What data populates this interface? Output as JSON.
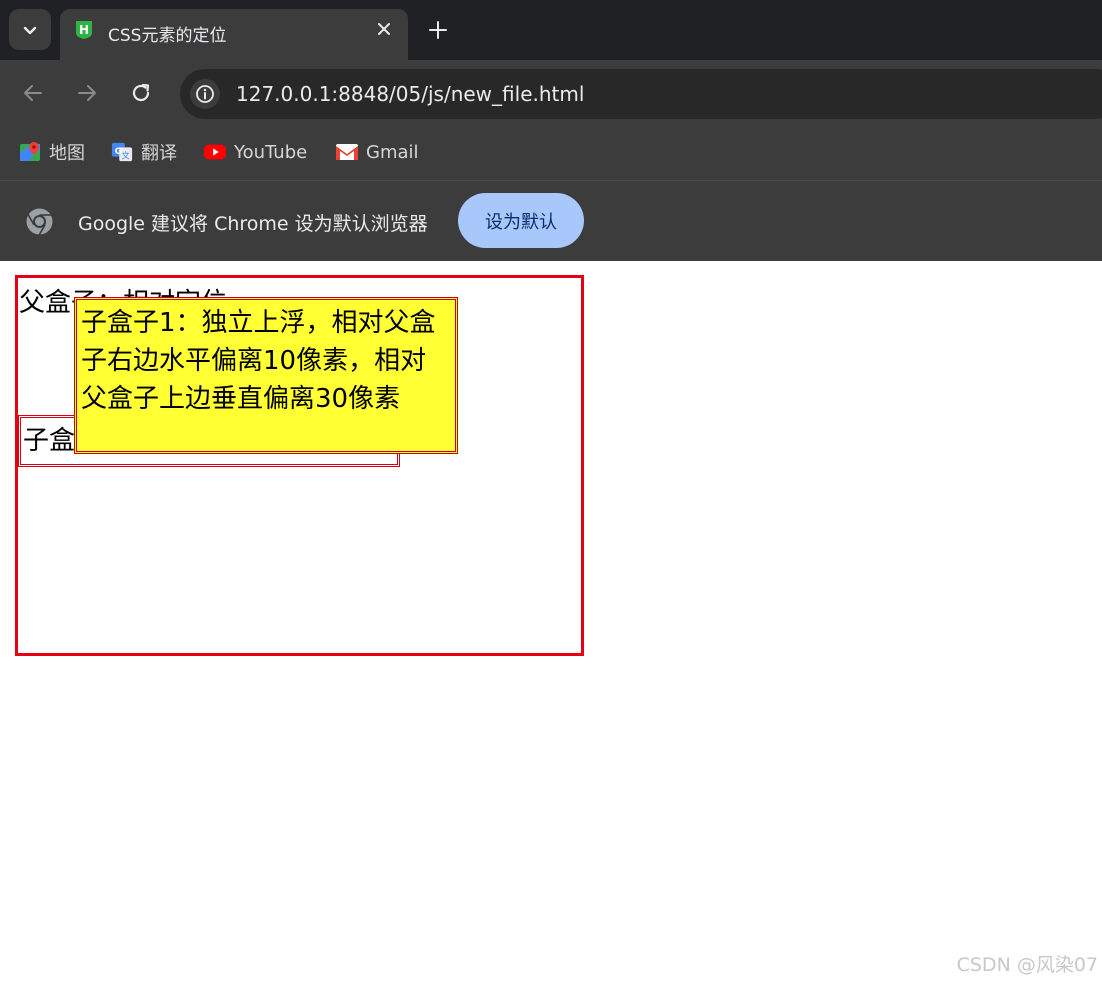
{
  "tab": {
    "title": "CSS元素的定位",
    "favicon_letter": "H"
  },
  "toolbar": {
    "url": "127.0.0.1:8848/05/js/new_file.html"
  },
  "bookmarks": [
    {
      "label": "地图",
      "icon": "maps-icon"
    },
    {
      "label": "翻译",
      "icon": "translate-icon"
    },
    {
      "label": "YouTube",
      "icon": "youtube-icon"
    },
    {
      "label": "Gmail",
      "icon": "gmail-icon"
    }
  ],
  "infobar": {
    "message": "Google 建议将 Chrome 设为默认浏览器",
    "button_label": "设为默认"
  },
  "page": {
    "parent_label": "父盒子：相对定位",
    "child1_label": "子盒子1：独立上浮，相对父盒子右边水平偏离10像素，相对父盒子上边垂直偏离30像素",
    "child2_label": "子盒子2"
  },
  "watermark": "CSDN @风染07",
  "colors": {
    "chrome_dark": "#202124",
    "chrome_toolbar": "#3c3c3c",
    "accent_button": "#a8c7fa",
    "border_red": "#e60012",
    "child_yellow": "#ffff33"
  }
}
